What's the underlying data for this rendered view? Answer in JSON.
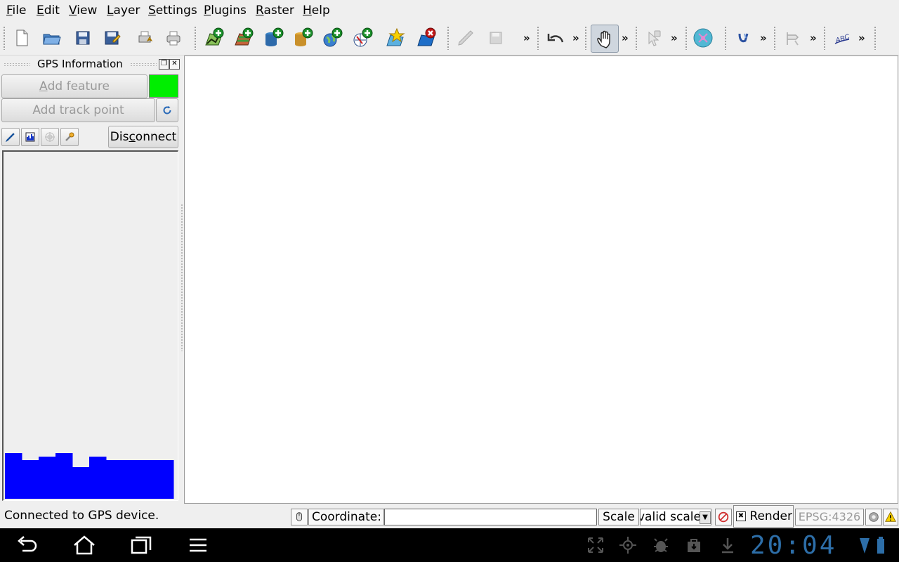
{
  "menubar": {
    "items": [
      {
        "label": "File",
        "accel": "F",
        "rest": "ile"
      },
      {
        "label": "Edit",
        "accel": "E",
        "rest": "dit"
      },
      {
        "label": "View",
        "accel": "V",
        "rest": "iew"
      },
      {
        "label": "Layer",
        "accel": "L",
        "rest": "ayer"
      },
      {
        "label": "Settings",
        "accel": "S",
        "rest": "ettings"
      },
      {
        "label": "Plugins",
        "accel": "P",
        "rest": "lugins"
      },
      {
        "label": "Raster",
        "accel": "R",
        "rest": "aster"
      },
      {
        "label": "Help",
        "accel": "H",
        "rest": "elp"
      }
    ]
  },
  "toolbar": {
    "more_label": "»",
    "icons": [
      "new-project-icon",
      "open-project-icon",
      "save-project-icon",
      "save-as-icon",
      "print-composer-icon",
      "print-icon",
      "add-vector-layer-icon",
      "add-raster-layer-icon",
      "add-postgis-layer-icon",
      "add-spatialite-layer-icon",
      "add-wms-layer-icon",
      "add-wfs-layer-icon",
      "new-layer-icon",
      "remove-layer-icon",
      "toggle-editing-icon",
      "save-edits-icon",
      "undo-icon",
      "pan-icon",
      "identify-icon",
      "gps-icon",
      "label-icon",
      "node-tool-icon",
      "abc-label-icon"
    ]
  },
  "dock": {
    "title": "GPS Information",
    "add_feature": {
      "label": "Add feature",
      "accel": "A",
      "rest": "dd feature"
    },
    "add_track_point": "Add track point",
    "disconnect": {
      "pre": "Dis",
      "accel": "c",
      "post": "onnect"
    },
    "status_color": "#00ee00",
    "signal_levels": [
      0.65,
      0.55,
      0.6,
      0.65,
      0.45,
      0.6,
      0.55,
      0.55,
      0.55,
      0.55
    ]
  },
  "statusbar": {
    "message": "Connected to GPS device.",
    "coordinate_label": "Coordinate:",
    "coordinate_value": "",
    "scale_label": "Scale",
    "scale_value": "valid scale",
    "render_label": "Render",
    "render_checked": true,
    "crs": "EPSG:4326"
  },
  "android": {
    "clock": "20:04"
  },
  "colors": {
    "accent": "#2d6ea8",
    "signal": "#0000ff"
  }
}
